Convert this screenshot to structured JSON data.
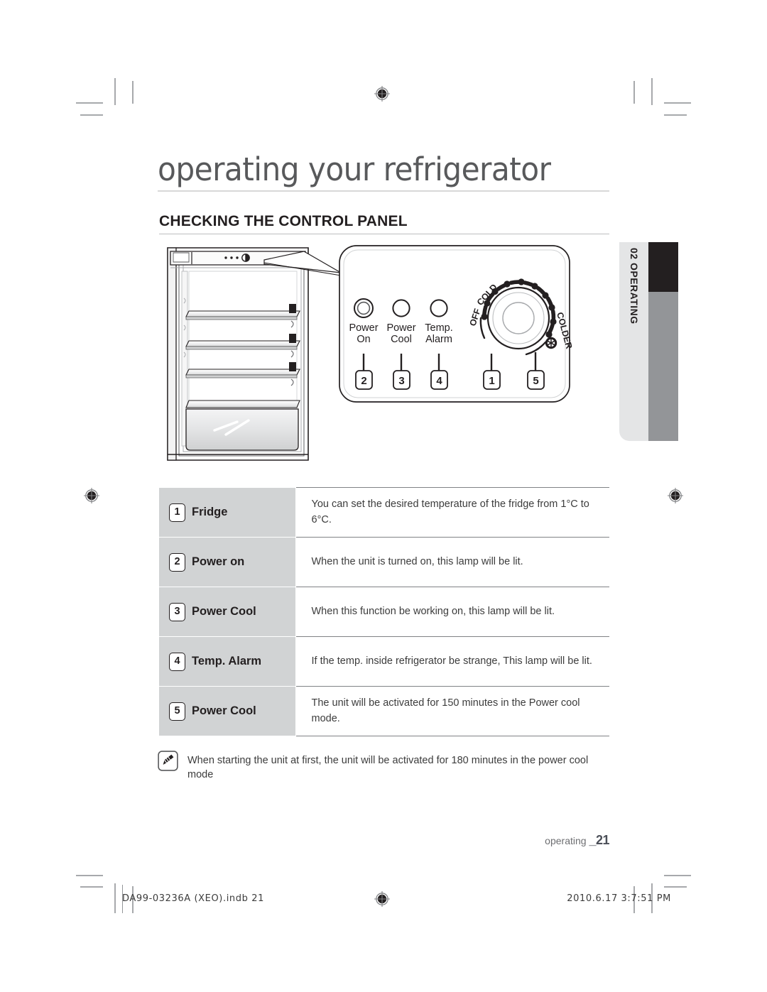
{
  "document": {
    "chapter_title": "operating your refrigerator",
    "section_title": "CHECKING THE CONTROL PANEL",
    "side_tab_label": "02 OPERATING"
  },
  "control_panel": {
    "indicators": [
      {
        "label_line1": "Power",
        "label_line2": "On",
        "callout": "2"
      },
      {
        "label_line1": "Power",
        "label_line2": "Cool",
        "callout": "3"
      },
      {
        "label_line1": "Temp.",
        "label_line2": "Alarm",
        "callout": "4"
      }
    ],
    "dial": {
      "label_off": "OFF",
      "label_cold": "COLD",
      "label_colder": "COLDER",
      "callout_dial": "1",
      "callout_powercool": "5"
    }
  },
  "table": {
    "rows": [
      {
        "num": "1",
        "label": "Fridge",
        "description": "You can set the desired temperature of the fridge from 1°C to 6°C."
      },
      {
        "num": "2",
        "label": "Power on",
        "description": "When the unit is turned on, this lamp will be lit."
      },
      {
        "num": "3",
        "label": "Power Cool",
        "description": "When this function be working on, this lamp will be lit."
      },
      {
        "num": "4",
        "label": "Temp. Alarm",
        "description": "If the temp. inside refrigerator be strange, This lamp will be lit."
      },
      {
        "num": "5",
        "label": "Power Cool",
        "description": "The unit will be activated for 150 minutes in the Power cool mode."
      }
    ]
  },
  "note": {
    "icon": "note-pen-icon",
    "text": "When starting the unit at first, the unit will be activated for 180 minutes in the power cool mode"
  },
  "footer": {
    "running_label": "operating ",
    "page_number": "_21",
    "slug_left": "DA99-03236A (XEO).indb   21",
    "slug_right": "2010.6.17   3:7:51 PM"
  },
  "colors": {
    "table_label_bg": "#d1d3d4",
    "tab_dark": "#231f20",
    "tab_grey": "#939598",
    "tab_light": "#e4e5e6",
    "rule": "#bcbec0",
    "text": "#231f20"
  }
}
